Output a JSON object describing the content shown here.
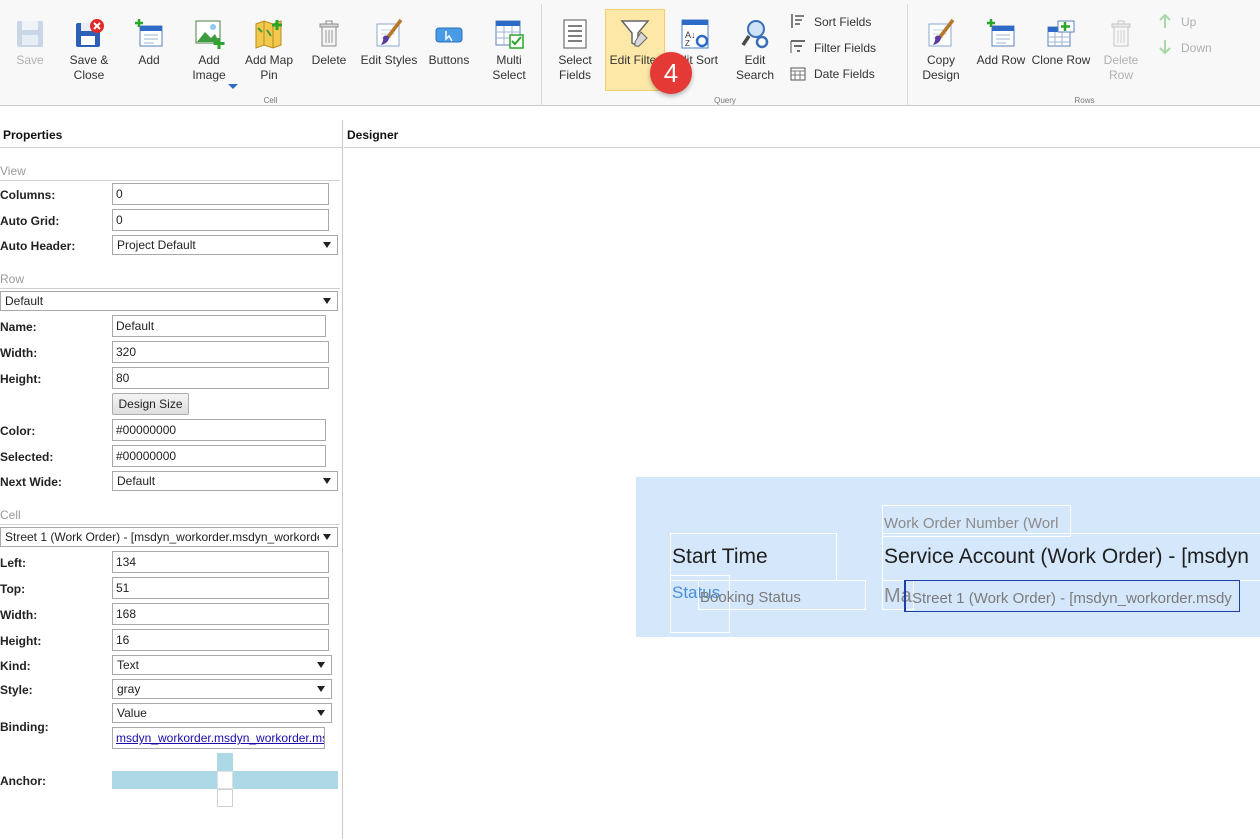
{
  "ribbon": {
    "groups": {
      "cell": "Cell",
      "query": "Query",
      "rows": "Rows"
    },
    "buttons": {
      "save": "Save",
      "save_close_1": "Save &",
      "save_close_2": "Close",
      "add": "Add",
      "add_image_1": "Add",
      "add_image_2": "Image",
      "add_map_pin_1": "Add Map",
      "add_map_pin_2": "Pin",
      "delete": "Delete",
      "edit_styles": "Edit Styles",
      "buttons": "Buttons",
      "multi_select_1": "Multi",
      "multi_select_2": "Select",
      "select_fields_1": "Select",
      "select_fields_2": "Fields",
      "edit_filter": "Edit Filter",
      "edit_sort": "Edit Sort",
      "edit_search_1": "Edit",
      "edit_search_2": "Search",
      "sort_fields": "Sort Fields",
      "filter_fields": "Filter Fields",
      "date_fields": "Date Fields",
      "copy_design_1": "Copy",
      "copy_design_2": "Design",
      "add_row": "Add Row",
      "clone_row": "Clone Row",
      "delete_row_1": "Delete",
      "delete_row_2": "Row",
      "up": "Up",
      "down": "Down"
    },
    "step_badge": "4"
  },
  "properties": {
    "title": "Properties",
    "view": {
      "section": "View",
      "columns_label": "Columns:",
      "columns_value": "0",
      "auto_grid_label": "Auto Grid:",
      "auto_grid_value": "0",
      "auto_header_label": "Auto Header:",
      "auto_header_value": "Project Default"
    },
    "row": {
      "section": "Row",
      "selector": "Default",
      "name_label": "Name:",
      "name_value": "Default",
      "width_label": "Width:",
      "width_value": "320",
      "height_label": "Height:",
      "height_value": "80",
      "design_size_button": "Design Size",
      "color_label": "Color:",
      "color_value": "#00000000",
      "selected_label": "Selected:",
      "selected_value": "#00000000",
      "next_wide_label": "Next Wide:",
      "next_wide_value": "Default"
    },
    "cell": {
      "section": "Cell",
      "selector": "Street 1 (Work Order) - [msdyn_workorder.msdyn_workorde",
      "left_label": "Left:",
      "left_value": "134",
      "top_label": "Top:",
      "top_value": "51",
      "width_label": "Width:",
      "width_value": "168",
      "height_label": "Height:",
      "height_value": "16",
      "kind_label": "Kind:",
      "kind_value": "Text",
      "style_label": "Style:",
      "style_value": "gray",
      "binding_label": "Binding:",
      "binding_type": "Value",
      "binding_value": "msdyn_workorder.msdyn_workorder.ms",
      "anchor_label": "Anchor:"
    }
  },
  "designer": {
    "title": "Designer",
    "cells": {
      "work_order_number": "Work Order Number (Worl",
      "start_time": "Start Time",
      "service_account": "Service Account (Work Order) - [msdyn",
      "status": "Status",
      "booking_status": "Booking Status",
      "ma_fragment": "Ma",
      "street_1": "Street 1 (Work Order) - [msdyn_workorder.msdy"
    }
  },
  "colors": {
    "canvas_bg": "#d5e7fb",
    "selection_border": "#1f3fa8",
    "active_button_bg": "#fde8a8",
    "badge_red": "#e53935",
    "anchor_bar": "#add8e6"
  }
}
